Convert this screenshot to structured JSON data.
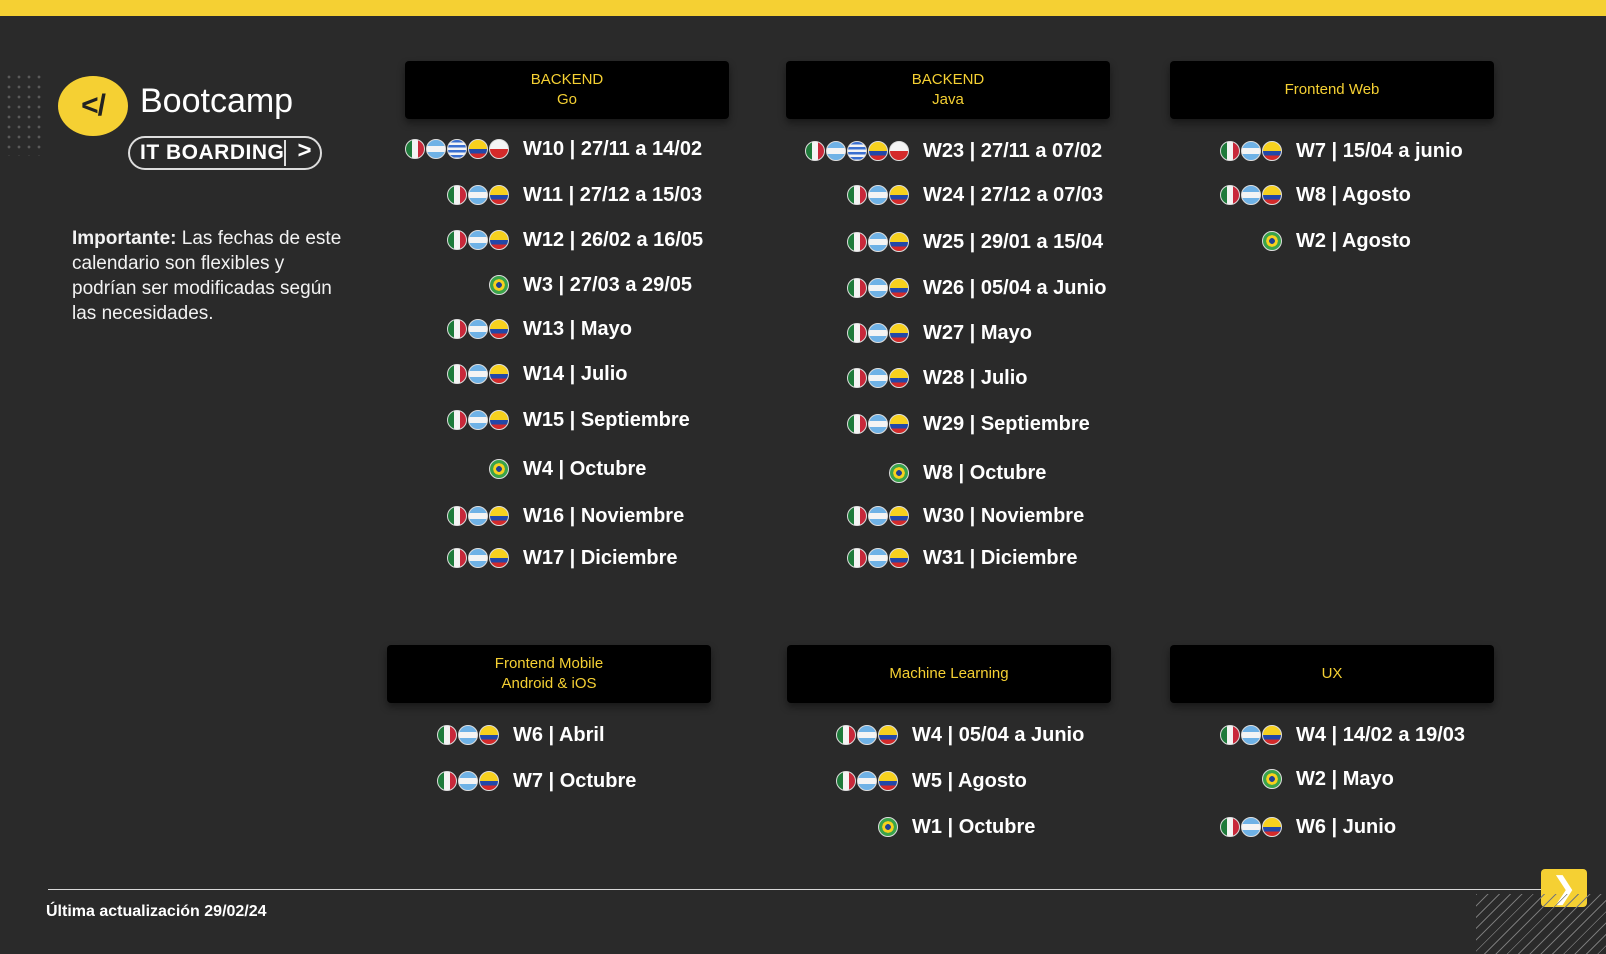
{
  "brand": {
    "logo_text": "</",
    "name": "Bootcamp",
    "tag": "IT BOARDING",
    "tag_chevron": ">"
  },
  "note": {
    "bold": "Importante:",
    "text": " Las fechas de este calendario son flexibles y podrían ser modificadas según las necesidades."
  },
  "colors": {
    "accent": "#f5d033",
    "background": "#2a2a2a",
    "header_bg": "#000000"
  },
  "tracks": {
    "backend_go": {
      "title": "BACKEND",
      "subtitle": "Go",
      "rows": [
        {
          "flags": [
            "mexico",
            "argentina",
            "uruguay",
            "colombia",
            "chile"
          ],
          "label": "W10 | 27/11 a 14/02"
        },
        {
          "flags": [
            "mexico",
            "argentina",
            "colombia"
          ],
          "label": "W11 | 27/12 a 15/03"
        },
        {
          "flags": [
            "mexico",
            "argentina",
            "colombia"
          ],
          "label": "W12 | 26/02 a 16/05"
        },
        {
          "flags": [
            "brasil"
          ],
          "label": "W3 | 27/03 a 29/05"
        },
        {
          "flags": [
            "mexico",
            "argentina",
            "colombia"
          ],
          "label": "W13 | Mayo"
        },
        {
          "flags": [
            "mexico",
            "argentina",
            "colombia"
          ],
          "label": "W14 | Julio"
        },
        {
          "flags": [
            "mexico",
            "argentina",
            "colombia"
          ],
          "label": "W15 | Septiembre"
        },
        {
          "flags": [
            "brasil"
          ],
          "label": "W4 | Octubre"
        },
        {
          "flags": [
            "mexico",
            "argentina",
            "colombia"
          ],
          "label": "W16 | Noviembre"
        },
        {
          "flags": [
            "mexico",
            "argentina",
            "colombia"
          ],
          "label": "W17 | Diciembre"
        }
      ]
    },
    "backend_java": {
      "title": "BACKEND",
      "subtitle": "Java",
      "rows": [
        {
          "flags": [
            "mexico",
            "argentina",
            "uruguay",
            "colombia",
            "chile"
          ],
          "label": "W23 | 27/11 a 07/02"
        },
        {
          "flags": [
            "mexico",
            "argentina",
            "colombia"
          ],
          "label": "W24 | 27/12 a 07/03"
        },
        {
          "flags": [
            "mexico",
            "argentina",
            "colombia"
          ],
          "label": "W25 | 29/01 a 15/04"
        },
        {
          "flags": [
            "mexico",
            "argentina",
            "colombia"
          ],
          "label": "W26 | 05/04 a Junio"
        },
        {
          "flags": [
            "mexico",
            "argentina",
            "colombia"
          ],
          "label": "W27 | Mayo"
        },
        {
          "flags": [
            "mexico",
            "argentina",
            "colombia"
          ],
          "label": "W28 | Julio"
        },
        {
          "flags": [
            "mexico",
            "argentina",
            "colombia"
          ],
          "label": "W29 | Septiembre"
        },
        {
          "flags": [
            "brasil"
          ],
          "label": "W8 | Octubre"
        },
        {
          "flags": [
            "mexico",
            "argentina",
            "colombia"
          ],
          "label": "W30 | Noviembre"
        },
        {
          "flags": [
            "mexico",
            "argentina",
            "colombia"
          ],
          "label": "W31 | Diciembre"
        }
      ]
    },
    "frontend_web": {
      "title": "Frontend Web",
      "rows": [
        {
          "flags": [
            "mexico",
            "argentina",
            "colombia"
          ],
          "label": "W7 | 15/04 a junio"
        },
        {
          "flags": [
            "mexico",
            "argentina",
            "colombia"
          ],
          "label": "W8 | Agosto"
        },
        {
          "flags": [
            "brasil"
          ],
          "label": "W2 | Agosto"
        }
      ]
    },
    "frontend_mobile": {
      "title": "Frontend Mobile",
      "subtitle": "Android & iOS",
      "rows": [
        {
          "flags": [
            "mexico",
            "argentina",
            "colombia"
          ],
          "label": "W6 | Abril"
        },
        {
          "flags": [
            "mexico",
            "argentina",
            "colombia"
          ],
          "label": "W7 | Octubre"
        }
      ]
    },
    "machine_learning": {
      "title": "Machine Learning",
      "rows": [
        {
          "flags": [
            "mexico",
            "argentina",
            "colombia"
          ],
          "label": "W4 | 05/04 a Junio"
        },
        {
          "flags": [
            "mexico",
            "argentina",
            "colombia"
          ],
          "label": "W5 | Agosto"
        },
        {
          "flags": [
            "brasil"
          ],
          "label": "W1 | Octubre"
        }
      ]
    },
    "ux": {
      "title": "UX",
      "rows": [
        {
          "flags": [
            "mexico",
            "argentina",
            "colombia"
          ],
          "label": "W4 | 14/02 a 19/03"
        },
        {
          "flags": [
            "brasil"
          ],
          "label": "W2 | Mayo"
        },
        {
          "flags": [
            "mexico",
            "argentina",
            "colombia"
          ],
          "label": "W6 | Junio"
        }
      ]
    }
  },
  "footer": {
    "updated": "Última actualización 29/02/24",
    "next_icon": "chevron-right-icon",
    "next_glyph": "❯"
  }
}
